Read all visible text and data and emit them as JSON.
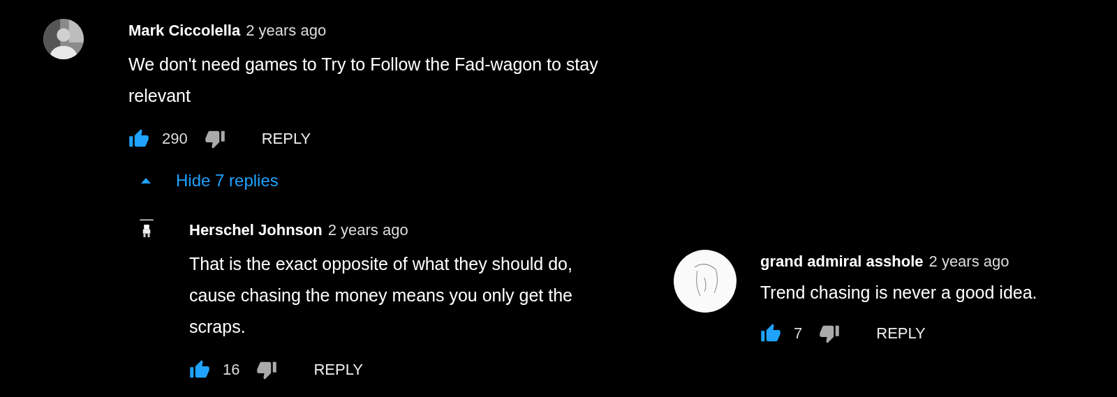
{
  "comments": [
    {
      "author": "Mark Ciccolella",
      "time": "2 years ago",
      "text": "We don't need games to Try to Follow the Fad-wagon to stay relevant",
      "likes": "290",
      "liked": true,
      "reply_label": "REPLY",
      "avatar": {
        "kind": "photo"
      },
      "replies_toggle": {
        "label": "Hide 7 replies",
        "expanded": true
      },
      "replies": [
        {
          "author": "Herschel Johnson",
          "time": "2 years ago",
          "text": "That is the exact opposite of what they should do, cause chasing the money means you only get the scraps.",
          "likes": "16",
          "liked": true,
          "reply_label": "REPLY",
          "avatar": {
            "kind": "pixel"
          }
        }
      ]
    },
    {
      "author": "grand admiral asshole",
      "time": "2 years ago",
      "text": "Trend chasing is never a good idea.",
      "likes": "7",
      "liked": true,
      "reply_label": "REPLY",
      "avatar": {
        "kind": "sketch"
      }
    }
  ]
}
